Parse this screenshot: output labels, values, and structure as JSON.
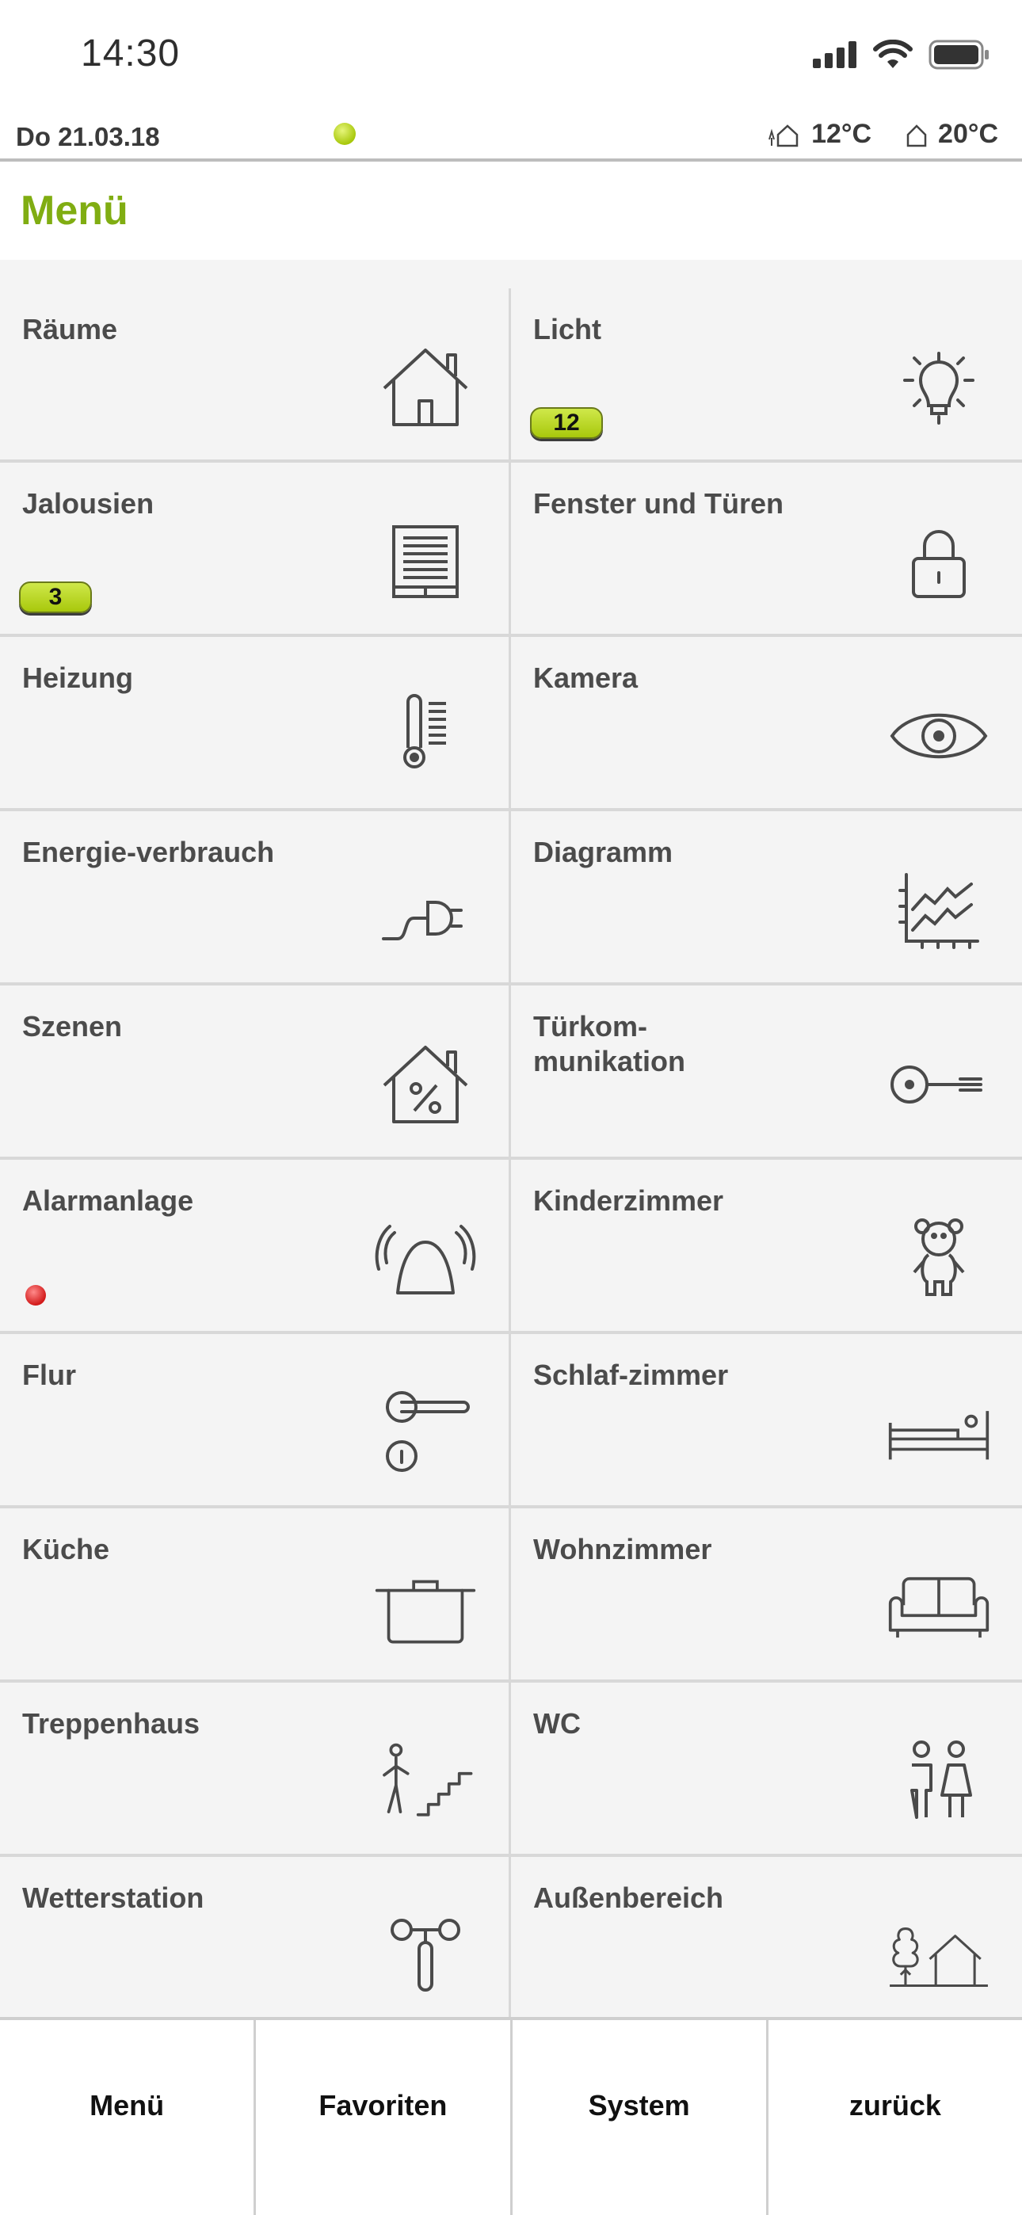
{
  "status": {
    "time": "14:30"
  },
  "info": {
    "date": "Do 21.03.18",
    "outdoor_temp": "12°C",
    "indoor_temp": "20°C"
  },
  "header": {
    "title": "Menü"
  },
  "tiles": [
    {
      "label": "Räume",
      "icon": "house-icon"
    },
    {
      "label": "Licht",
      "icon": "lightbulb-icon",
      "badge": "12"
    },
    {
      "label": "Jalousien",
      "icon": "blind-icon",
      "badge": "3"
    },
    {
      "label": "Fenster und Türen",
      "icon": "lock-icon"
    },
    {
      "label": "Heizung",
      "icon": "thermometer-icon"
    },
    {
      "label": "Kamera",
      "icon": "eye-icon"
    },
    {
      "label": "Energie-verbrauch",
      "icon": "plug-icon"
    },
    {
      "label": "Diagramm",
      "icon": "chart-icon"
    },
    {
      "label": "Szenen",
      "icon": "house-percent-icon"
    },
    {
      "label": "Türkom-\nmunikation",
      "icon": "key-icon"
    },
    {
      "label": "Alarmanlage",
      "icon": "alarm-bell-icon",
      "alert": true
    },
    {
      "label": "Kinderzimmer",
      "icon": "teddy-bear-icon"
    },
    {
      "label": "Flur",
      "icon": "door-handle-icon"
    },
    {
      "label": "Schlaf-zimmer",
      "icon": "bed-icon"
    },
    {
      "label": "Küche",
      "icon": "cooking-pot-icon"
    },
    {
      "label": "Wohnzimmer",
      "icon": "sofa-icon"
    },
    {
      "label": "Treppenhaus",
      "icon": "stairs-icon"
    },
    {
      "label": "WC",
      "icon": "toilet-people-icon"
    },
    {
      "label": "Wetterstation",
      "icon": "weather-station-icon"
    },
    {
      "label": "Außenbereich",
      "icon": "outdoor-tree-house-icon"
    }
  ],
  "nav": {
    "menu": "Menü",
    "favorites": "Favoriten",
    "system": "System",
    "back": "zurück"
  },
  "colors": {
    "accent": "#80ad12",
    "badge": "#a8c80c",
    "alert": "#d21a1a"
  }
}
